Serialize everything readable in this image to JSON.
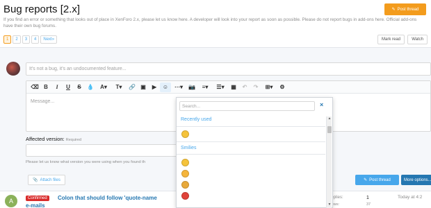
{
  "header": {
    "title": "Bug reports [2.x]",
    "post_thread": "Post thread",
    "description": "If you find an error or something that looks out of place in XenForo 2.x, please let us know here. A developer will look into your report as soon as possible. Please do not report bugs in add-ons here. Official add-ons have their own bug forums."
  },
  "pager": {
    "pages": [
      "1",
      "2",
      "3",
      "4"
    ],
    "next": "Next»",
    "current": "1"
  },
  "actions": {
    "mark_read": "Mark read",
    "watch": "Watch"
  },
  "quick_thread": {
    "title_placeholder": "It's not a bug, it's an undocumented feature...",
    "message_placeholder": "Message...",
    "toolbar": [
      "clear-format",
      "bold",
      "italic",
      "underline",
      "strikethrough",
      "text-color",
      "font-size",
      "font-family",
      "link",
      "image",
      "media",
      "smilies",
      "more-text",
      "insert-image",
      "align",
      "list",
      "table",
      "undo",
      "redo",
      "toggle-bbcode",
      "preview"
    ],
    "affected_label": "Affected version:",
    "affected_required": "Required",
    "hint": "Please let us know what version you were using when you found th",
    "attach_files": "Attach files",
    "post_thread": "Post thread",
    "more_options": "More options..."
  },
  "emoji_popup": {
    "search_placeholder": "Search...",
    "close": "×",
    "recently_used": "Recently used",
    "smilies": "Smilies",
    "recent": [
      {
        "name": "smile",
        "color": "#f5c33b"
      }
    ],
    "smilies_list": [
      {
        "name": "smile",
        "color": "#f5c33b"
      },
      {
        "name": "wink",
        "color": "#f5b53b"
      },
      {
        "name": "frown",
        "color": "#e8a93a"
      },
      {
        "name": "mad",
        "color": "#e0433a"
      }
    ]
  },
  "thread": {
    "avatar_letter": "A",
    "badge": "Confirmed",
    "title_line1": "Colon that should follow 'quote-name",
    "title_line2": "e-mails",
    "replies_label": "Replies:",
    "replies": "1",
    "views_label": "Views:",
    "views": "37",
    "last_post": "Today at 4:2"
  },
  "colors": {
    "accent": "#47a7eb",
    "orange": "#f39c1d",
    "confirmed": "#d92b2b",
    "link": "#2577b1"
  }
}
